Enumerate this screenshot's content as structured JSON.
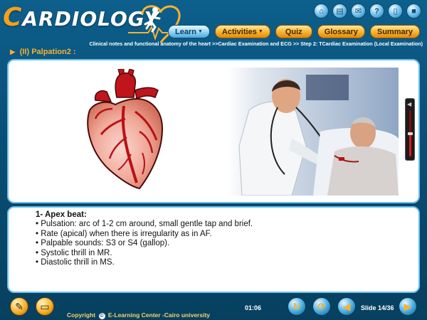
{
  "app": {
    "logo_first_letter": "C",
    "logo_rest": "ARDIOLOGY"
  },
  "top_icons": [
    {
      "name": "home-icon",
      "glyph": "⌂"
    },
    {
      "name": "print-icon",
      "glyph": "▤"
    },
    {
      "name": "mail-icon",
      "glyph": "✉"
    },
    {
      "name": "help-icon",
      "glyph": "?"
    },
    {
      "name": "notes-icon",
      "glyph": "▯"
    },
    {
      "name": "exit-icon",
      "glyph": "■"
    }
  ],
  "nav": {
    "learn": "Learn",
    "activities": "Activities",
    "quiz": "Quiz",
    "glossary": "Glossary",
    "summary": "Summary"
  },
  "breadcrumb": "Clinical notes and functional anatomy of the heart >>Cardiac Examination and ECG >> Step 2: TCardiac Examination (Local Examination)",
  "slide": {
    "title": "(II) Palpation2 :"
  },
  "media": {
    "volume_level": 0.5
  },
  "content": {
    "heading": "1- Apex beat:",
    "bullets": [
      "Pulsation: arc of 1-2 cm around, small gentle tap and brief.",
      "Rate (apical) when there is irregularity as in AF.",
      "Palpable sounds: S3 or S4 (gallop).",
      "Systolic thrill in MR.",
      "Diastolic thrill in MS."
    ]
  },
  "footer": {
    "copyright": "E-Learning Center -Cairo university",
    "copyright_prefix": "Copyright",
    "timer": "01:06",
    "slide_label": "Slide 14/36"
  },
  "colors": {
    "accent_orange": "#f7b22d",
    "background_blue": "#0a4f78",
    "panel_border": "#6cc0ea"
  }
}
